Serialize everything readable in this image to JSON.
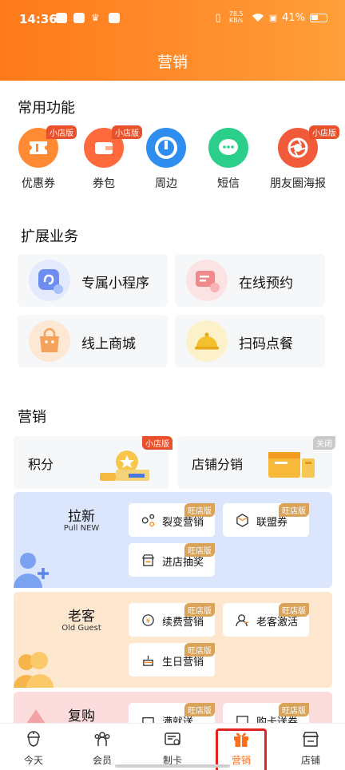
{
  "status_bar": {
    "time": "14:36",
    "speed": "78.5 KB/s",
    "battery": "41%"
  },
  "header": {
    "title": "营销"
  },
  "common": {
    "title": "常用功能",
    "items": [
      {
        "label": "优惠券",
        "tag": "小店版",
        "color": "#ff8a33"
      },
      {
        "label": "券包",
        "tag": "小店版",
        "color": "#ff6a3d"
      },
      {
        "label": "周边",
        "tag": "",
        "color": "#2f8df0"
      },
      {
        "label": "短信",
        "tag": "",
        "color": "#2ccf8a"
      },
      {
        "label": "朋友圈海报",
        "tag": "小店版",
        "color": "#f25b3a"
      }
    ]
  },
  "extended": {
    "title": "扩展业务",
    "items": [
      {
        "label": "专属小程序"
      },
      {
        "label": "在线预约"
      },
      {
        "label": "线上商城"
      },
      {
        "label": "扫码点餐"
      }
    ]
  },
  "marketing": {
    "title": "营销",
    "top_cards": [
      {
        "label": "积分",
        "tag": "小店版"
      },
      {
        "label": "店铺分销",
        "tag": "关闭"
      }
    ],
    "panels": [
      {
        "title": "拉新",
        "subtitle": "Pull NEW",
        "chips": [
          {
            "label": "裂变营销",
            "tag": "旺店版"
          },
          {
            "label": "联盟券",
            "tag": "旺店版"
          },
          {
            "label": "进店抽奖",
            "tag": "旺店版"
          }
        ]
      },
      {
        "title": "老客",
        "subtitle": "Old Guest",
        "chips": [
          {
            "label": "续费营销",
            "tag": "旺店版"
          },
          {
            "label": "老客激活",
            "tag": "旺店版"
          },
          {
            "label": "生日营销",
            "tag": "旺店版"
          }
        ]
      },
      {
        "title": "复购",
        "subtitle": "",
        "chips": [
          {
            "label": "满就送",
            "tag": "旺店版"
          },
          {
            "label": "购卡送券",
            "tag": "旺店版"
          }
        ]
      }
    ]
  },
  "bottom_nav": {
    "items": [
      {
        "label": "今天"
      },
      {
        "label": "会员"
      },
      {
        "label": "制卡"
      },
      {
        "label": "营销"
      },
      {
        "label": "店铺"
      }
    ],
    "active": "营销"
  }
}
